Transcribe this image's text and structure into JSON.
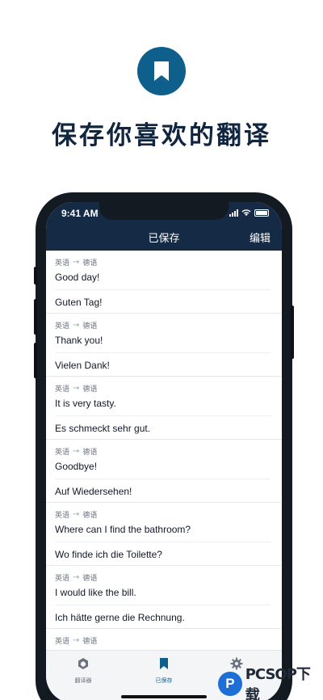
{
  "promo": {
    "title": "保存你喜欢的翻译",
    "icon": "bookmark-icon",
    "badge_color": "#0f5f8c"
  },
  "status_bar": {
    "time": "9:41 AM"
  },
  "nav": {
    "title": "已保存",
    "edit_label": "编辑"
  },
  "saved": {
    "items": [
      {
        "source_lang": "英语",
        "target_lang": "德语",
        "source": "Good day!",
        "target": "Guten Tag!"
      },
      {
        "source_lang": "英语",
        "target_lang": "德语",
        "source": "Thank you!",
        "target": "Vielen Dank!"
      },
      {
        "source_lang": "英语",
        "target_lang": "德语",
        "source": "It is very tasty.",
        "target": "Es schmeckt sehr gut."
      },
      {
        "source_lang": "英语",
        "target_lang": "德语",
        "source": "Goodbye!",
        "target": "Auf Wiedersehen!"
      },
      {
        "source_lang": "英语",
        "target_lang": "德语",
        "source": "Where can I find the bathroom?",
        "target": "Wo finde ich die Toilette?"
      },
      {
        "source_lang": "英语",
        "target_lang": "德语",
        "source": "I would like the bill.",
        "target": "Ich hätte gerne die Rechnung."
      },
      {
        "source_lang": "英语",
        "target_lang": "德语",
        "source": "",
        "target": ""
      }
    ]
  },
  "tabs": [
    {
      "label": "翻译器",
      "icon": "cube-icon",
      "active": false
    },
    {
      "label": "已保存",
      "icon": "bookmark-icon",
      "active": true
    },
    {
      "label": "",
      "icon": "gear-icon",
      "active": false
    }
  ],
  "watermark": {
    "text": "PCSOP下载",
    "icon_letter": "P"
  },
  "colors": {
    "header": "#142a45",
    "accent": "#0f5f8c",
    "title": "#0f2540"
  }
}
